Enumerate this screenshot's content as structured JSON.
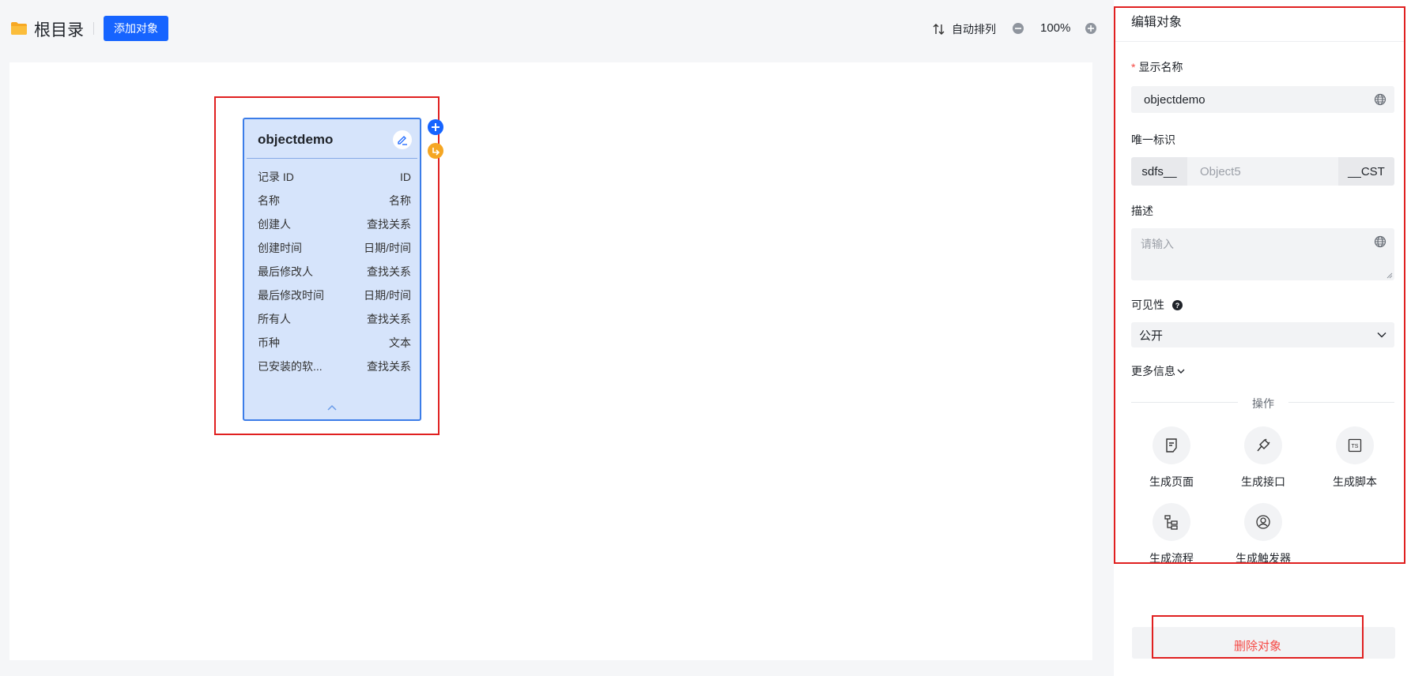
{
  "header": {
    "breadcrumb": "根目录",
    "add_button": "添加对象",
    "auto_arrange": "自动排列",
    "zoom": "100%"
  },
  "card": {
    "title": "objectdemo",
    "fields": [
      {
        "name": "记录 ID",
        "type": "ID"
      },
      {
        "name": "名称",
        "type": "名称"
      },
      {
        "name": "创建人",
        "type": "查找关系"
      },
      {
        "name": "创建时间",
        "type": "日期/时间"
      },
      {
        "name": "最后修改人",
        "type": "查找关系"
      },
      {
        "name": "最后修改时间",
        "type": "日期/时间"
      },
      {
        "name": "所有人",
        "type": "查找关系"
      },
      {
        "name": "币种",
        "type": "文本"
      },
      {
        "name": "已安装的软...",
        "type": "查找关系"
      }
    ]
  },
  "panel": {
    "title": "编辑对象",
    "display_name_label": "显示名称",
    "display_name_value": "objectdemo",
    "unique_id_label": "唯一标识",
    "unique_id_prefix": "sdfs__",
    "unique_id_placeholder": "Object5",
    "unique_id_suffix": "__CST",
    "description_label": "描述",
    "description_placeholder": "请输入",
    "visibility_label": "可见性",
    "visibility_value": "公开",
    "more_info": "更多信息",
    "ops_title": "操作",
    "ops": [
      {
        "label": "生成页面",
        "icon": "page-icon"
      },
      {
        "label": "生成接口",
        "icon": "plug-icon"
      },
      {
        "label": "生成脚本",
        "icon": "ts-script-icon"
      },
      {
        "label": "生成流程",
        "icon": "flow-icon"
      },
      {
        "label": "生成触发器",
        "icon": "trigger-icon"
      }
    ],
    "delete_button": "删除对象"
  },
  "colors": {
    "primary": "#1664ff",
    "card_bg": "#d6e4fb",
    "card_border": "#3c7de8",
    "danger": "#f54a45",
    "highlight": "#e02020"
  }
}
